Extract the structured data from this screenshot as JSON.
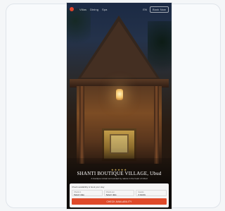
{
  "header": {
    "logo_icon": "resort-logo-icon",
    "nav": [
      "Villas",
      "Dining",
      "Spa"
    ],
    "lang": "EN",
    "book_label": "Book Now"
  },
  "hero": {
    "rating_stars": "★★★★★",
    "title": "SHANTI BOUTIQUE VILLAGE, Ubud",
    "subtitle": "A boutique retreat surrounded by nature in the heart of Ubud"
  },
  "booking": {
    "heading": "Check availability & book your stay",
    "fields": [
      {
        "label": "Check-in",
        "value": "Select date"
      },
      {
        "label": "Check-out",
        "value": "Select date"
      },
      {
        "label": "Guests",
        "value": "2 Adults"
      }
    ],
    "cta": "CHECK AVAILABILITY"
  },
  "colors": {
    "accent": "#df4a2a",
    "gold": "#d7b65b"
  }
}
